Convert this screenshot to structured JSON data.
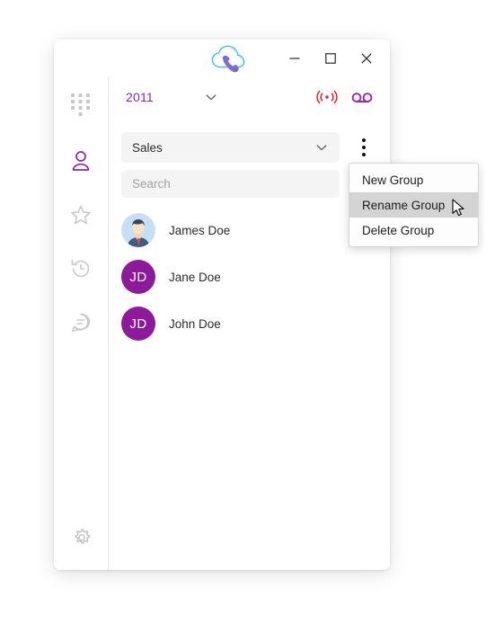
{
  "window": {
    "logo": {
      "icon": "cloud-phone-logo",
      "cloud_color": "#29b6f6",
      "handset_color": "#7e6bd0"
    },
    "controls": [
      {
        "name": "minimize",
        "glyph": "minimize-icon"
      },
      {
        "name": "maximize",
        "glyph": "maximize-icon"
      },
      {
        "name": "close",
        "glyph": "close-icon"
      }
    ]
  },
  "rail": {
    "items": [
      {
        "name": "dialpad",
        "icon": "dialpad-icon",
        "active": false,
        "color": "#c9c9c9"
      },
      {
        "name": "contacts",
        "icon": "person-icon",
        "active": true,
        "color": "#8d2ba0"
      },
      {
        "name": "favorites",
        "icon": "star-icon",
        "active": false,
        "color": "#c9c9c9"
      },
      {
        "name": "history",
        "icon": "history-clock-icon",
        "active": false,
        "color": "#c9c9c9"
      },
      {
        "name": "messages",
        "icon": "chat-bubble-icon",
        "active": false,
        "color": "#c9c9c9"
      }
    ],
    "settings": {
      "name": "settings",
      "icon": "gear-icon",
      "color": "#c2c2c2"
    }
  },
  "account": {
    "extension": "2011",
    "extension_color": "#8d2ba0",
    "caret_icon": "chevron-down-icon",
    "status_icon": "broadcast-signal-icon",
    "status_color": "#ee1c25",
    "voicemail_icon": "voicemail-icon",
    "voicemail_color": "#9c27b0"
  },
  "group_select": {
    "value": "Sales",
    "caret_icon": "chevron-down-icon",
    "options": [
      "Sales"
    ]
  },
  "kebab": {
    "icon": "more-vertical-icon"
  },
  "search": {
    "value": "",
    "placeholder": "Search"
  },
  "contacts": [
    {
      "name": "James Doe",
      "avatar_type": "photo",
      "initials": ""
    },
    {
      "name": "Jane Doe",
      "avatar_type": "initials",
      "initials": "JD",
      "avatar_color": "#8d1a9b"
    },
    {
      "name": "John Doe",
      "avatar_type": "initials",
      "initials": "JD",
      "avatar_color": "#8d1a9b"
    }
  ],
  "context_menu": {
    "items": [
      {
        "label": "New Group",
        "highlighted": false
      },
      {
        "label": "Rename Group",
        "highlighted": true
      },
      {
        "label": "Delete Group",
        "highlighted": false
      }
    ],
    "highlight_color": "#d4d4d4"
  }
}
